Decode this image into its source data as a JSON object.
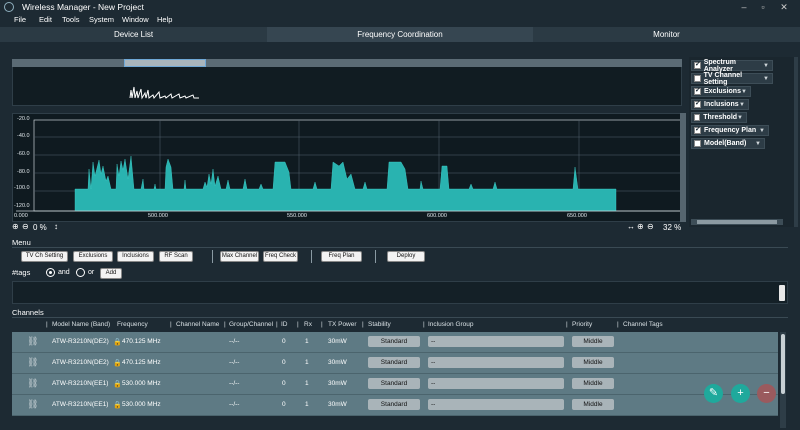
{
  "window": {
    "title": "Wireless Manager - New Project",
    "minimize": "–",
    "restore": "▫",
    "close": "✕"
  },
  "menu": [
    "File",
    "Edit",
    "Tools",
    "System",
    "Window",
    "Help"
  ],
  "tabs": [
    "Device List",
    "Frequency Coordination",
    "Monitor"
  ],
  "spectrum": {
    "y_ticks": [
      "-20.0",
      "-40.0",
      "-60.0",
      "-80.0",
      "-100.0",
      "-120.0"
    ],
    "x_ticks": [
      "0.000",
      "500.000",
      "550.000",
      "600.000",
      "650.000"
    ],
    "left_zoom": "0 %",
    "right_zoom": "32 %"
  },
  "panel_items": [
    {
      "label": "Spectrum Analyzer",
      "checked": true
    },
    {
      "label": "TV Channel Setting",
      "checked": false
    },
    {
      "label": "Exclusions",
      "checked": true
    },
    {
      "label": "Inclusions",
      "checked": true
    },
    {
      "label": "Threshold",
      "checked": false
    },
    {
      "label": "Frequency Plan",
      "checked": true
    },
    {
      "label": "Model(Band)",
      "checked": false
    }
  ],
  "menu_section": {
    "label": "Menu",
    "buttons": [
      "TV Ch Setting",
      "Exclusions",
      "Inclusions",
      "RF Scan",
      "Max Channel",
      "Freq Check",
      "Freq Plan",
      "Deploy"
    ]
  },
  "tags": {
    "label": "#tags",
    "and": "and",
    "or": "or",
    "add": "Add"
  },
  "channels": {
    "label": "Channels",
    "columns": [
      "Model Name (Band)",
      "Frequency",
      "Channel Name",
      "Group/Channel",
      "ID",
      "Rx",
      "TX Power",
      "Stability",
      "Inclusion Group",
      "Priority",
      "Channel Tags"
    ],
    "rows": [
      {
        "model": "ATW-R3210N(DE2)",
        "freq": "470.125 MHz",
        "group": "--/--",
        "id": "0",
        "rx": "1",
        "tx": "30mW",
        "stability": "Standard",
        "inclusion": "--",
        "priority": "Middle"
      },
      {
        "model": "ATW-R3210N(DE2)",
        "freq": "470.125 MHz",
        "group": "--/--",
        "id": "0",
        "rx": "1",
        "tx": "30mW",
        "stability": "Standard",
        "inclusion": "--",
        "priority": "Middle"
      },
      {
        "model": "ATW-R3210N(EE1)",
        "freq": "530.000 MHz",
        "group": "--/--",
        "id": "0",
        "rx": "1",
        "tx": "30mW",
        "stability": "Standard",
        "inclusion": "--",
        "priority": "Middle"
      },
      {
        "model": "ATW-R3210N(EE1)",
        "freq": "530.000 MHz",
        "group": "--/--",
        "id": "0",
        "rx": "1",
        "tx": "30mW",
        "stability": "Standard",
        "inclusion": "--",
        "priority": "Middle"
      }
    ]
  },
  "colors": {
    "accent": "#29b3b0",
    "fab_green": "#1fa99c",
    "fab_red": "#b05a5a",
    "row_bg": "#5e7a84"
  }
}
